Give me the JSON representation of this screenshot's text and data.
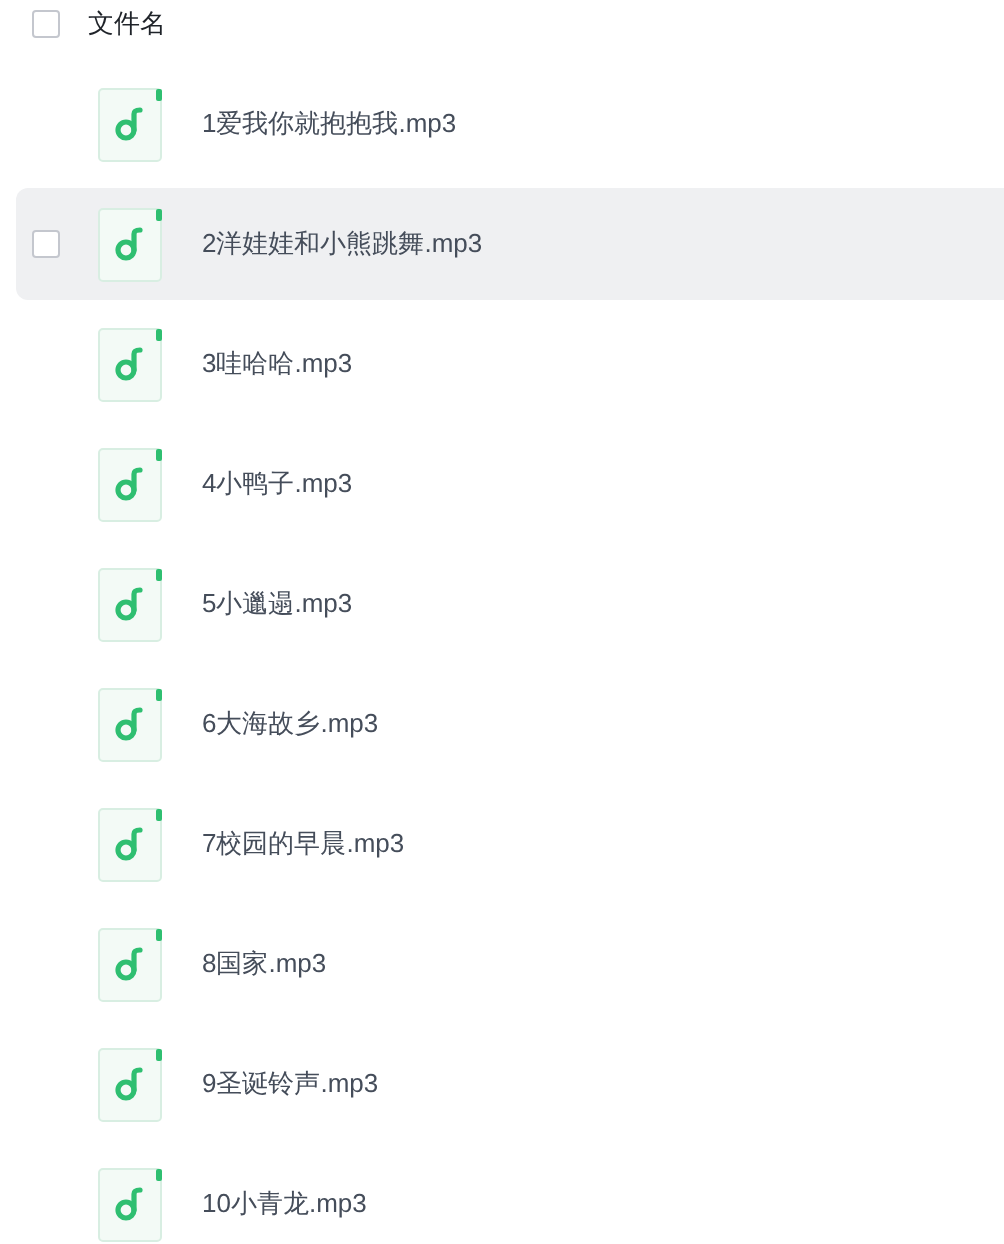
{
  "header": {
    "label": "文件名",
    "checked": false
  },
  "files": [
    {
      "name": "1爱我你就抱抱我.mp3",
      "hovered": false
    },
    {
      "name": "2洋娃娃和小熊跳舞.mp3",
      "hovered": true
    },
    {
      "name": "3哇哈哈.mp3",
      "hovered": false
    },
    {
      "name": "4小鸭子.mp3",
      "hovered": false
    },
    {
      "name": "5小邋遢.mp3",
      "hovered": false
    },
    {
      "name": "6大海故乡.mp3",
      "hovered": false
    },
    {
      "name": "7校园的早晨.mp3",
      "hovered": false
    },
    {
      "name": "8国家.mp3",
      "hovered": false
    },
    {
      "name": "9圣诞铃声.mp3",
      "hovered": false
    },
    {
      "name": "10小青龙.mp3",
      "hovered": false
    }
  ]
}
